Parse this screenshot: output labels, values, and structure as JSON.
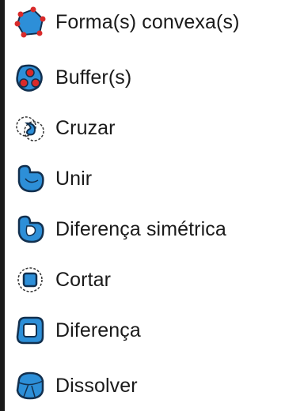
{
  "menu": {
    "items": [
      {
        "label": "Forma(s) convexa(s)",
        "icon": "convex-hull-icon"
      },
      {
        "label": "Buffer(s)",
        "icon": "buffer-icon"
      },
      {
        "label": "Cruzar",
        "icon": "intersect-icon"
      },
      {
        "label": "Unir",
        "icon": "union-icon"
      },
      {
        "label": "Diferença simétrica",
        "icon": "symmetric-difference-icon"
      },
      {
        "label": "Cortar",
        "icon": "clip-icon"
      },
      {
        "label": "Diferença",
        "icon": "difference-icon"
      },
      {
        "label": "Dissolver",
        "icon": "dissolve-icon"
      }
    ]
  },
  "colors": {
    "icon_fill": "#2d8fd8",
    "icon_outline": "#12304f",
    "vertex_red": "#d92a2a",
    "text": "#1a1a1a"
  }
}
